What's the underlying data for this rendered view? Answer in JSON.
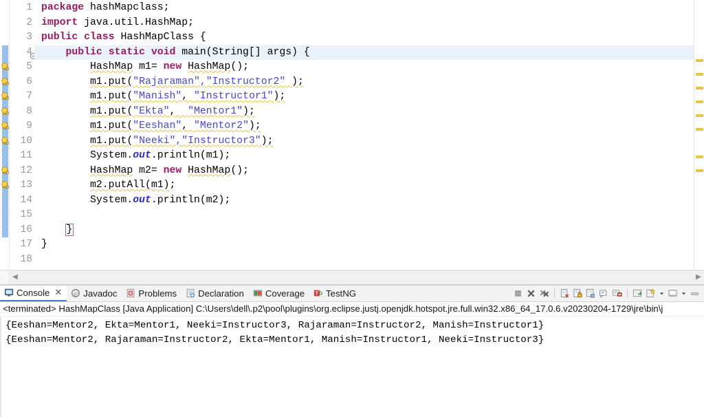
{
  "editor": {
    "name": "java-code-editor",
    "total_lines": 18,
    "highlighted_line": 4,
    "lines": [
      {
        "n": 1,
        "warn": false,
        "changed": false,
        "fold": false,
        "tokens": [
          {
            "t": "package",
            "c": "kw"
          },
          {
            "t": " hashMapclass;",
            "c": "plain"
          }
        ]
      },
      {
        "n": 2,
        "warn": false,
        "changed": false,
        "fold": false,
        "tokens": [
          {
            "t": "import",
            "c": "kw"
          },
          {
            "t": " java.util.HashMap;",
            "c": "plain"
          }
        ]
      },
      {
        "n": 3,
        "warn": false,
        "changed": false,
        "fold": false,
        "tokens": [
          {
            "t": "public class",
            "c": "kw"
          },
          {
            "t": " HashMapClass {",
            "c": "plain"
          }
        ]
      },
      {
        "n": 4,
        "warn": false,
        "changed": true,
        "fold": true,
        "tokens": [
          {
            "t": "    ",
            "c": "plain"
          },
          {
            "t": "public static void",
            "c": "kw"
          },
          {
            "t": " main(String[] args) {",
            "c": "plain"
          }
        ]
      },
      {
        "n": 5,
        "warn": true,
        "changed": true,
        "fold": false,
        "tokens": [
          {
            "t": "        ",
            "c": "plain"
          },
          {
            "t": "HashMap",
            "c": "sq"
          },
          {
            "t": " m1= ",
            "c": "plain"
          },
          {
            "t": "new",
            "c": "kw"
          },
          {
            "t": " ",
            "c": "plain"
          },
          {
            "t": "HashMap",
            "c": "sq"
          },
          {
            "t": "();",
            "c": "plain"
          }
        ]
      },
      {
        "n": 6,
        "warn": true,
        "changed": true,
        "fold": false,
        "tokens": [
          {
            "t": "        ",
            "c": "plain"
          },
          {
            "t": "m1.put(",
            "c": "sq"
          },
          {
            "t": "\"Rajaraman\",\"Instructor2\"",
            "c": "str sq"
          },
          {
            "t": " );",
            "c": "sq"
          }
        ]
      },
      {
        "n": 7,
        "warn": true,
        "changed": true,
        "fold": false,
        "tokens": [
          {
            "t": "        ",
            "c": "plain"
          },
          {
            "t": "m1.put(",
            "c": "sq"
          },
          {
            "t": "\"Manish\"",
            "c": "str sq"
          },
          {
            "t": ", ",
            "c": "sq"
          },
          {
            "t": "\"Instructor1\"",
            "c": "str sq"
          },
          {
            "t": ");",
            "c": "sq"
          }
        ]
      },
      {
        "n": 8,
        "warn": true,
        "changed": true,
        "fold": false,
        "tokens": [
          {
            "t": "        ",
            "c": "plain"
          },
          {
            "t": "m1.put(",
            "c": "sq"
          },
          {
            "t": "\"Ekta\"",
            "c": "str sq"
          },
          {
            "t": ",  ",
            "c": "sq"
          },
          {
            "t": "\"Mentor1\"",
            "c": "str sq"
          },
          {
            "t": ");",
            "c": "sq"
          }
        ]
      },
      {
        "n": 9,
        "warn": true,
        "changed": true,
        "fold": false,
        "tokens": [
          {
            "t": "        ",
            "c": "plain"
          },
          {
            "t": "m1.put(",
            "c": "sq"
          },
          {
            "t": "\"Eeshan\"",
            "c": "str sq"
          },
          {
            "t": ", ",
            "c": "sq"
          },
          {
            "t": "\"Mentor2\"",
            "c": "str sq"
          },
          {
            "t": ");",
            "c": "sq"
          }
        ]
      },
      {
        "n": 10,
        "warn": true,
        "changed": true,
        "fold": false,
        "tokens": [
          {
            "t": "        ",
            "c": "plain"
          },
          {
            "t": "m1.put(",
            "c": "sq"
          },
          {
            "t": "\"Neeki\",\"Instructor3\"",
            "c": "str sq"
          },
          {
            "t": ");",
            "c": "sq"
          }
        ]
      },
      {
        "n": 11,
        "warn": false,
        "changed": true,
        "fold": false,
        "tokens": [
          {
            "t": "        System.",
            "c": "plain"
          },
          {
            "t": "out",
            "c": "fld"
          },
          {
            "t": ".println(m1);",
            "c": "plain"
          }
        ]
      },
      {
        "n": 12,
        "warn": true,
        "changed": true,
        "fold": false,
        "tokens": [
          {
            "t": "        ",
            "c": "plain"
          },
          {
            "t": "HashMap",
            "c": "sq"
          },
          {
            "t": " m2= ",
            "c": "plain"
          },
          {
            "t": "new",
            "c": "kw"
          },
          {
            "t": " ",
            "c": "plain"
          },
          {
            "t": "HashMap",
            "c": "sq"
          },
          {
            "t": "();",
            "c": "plain"
          }
        ]
      },
      {
        "n": 13,
        "warn": true,
        "changed": true,
        "fold": false,
        "tokens": [
          {
            "t": "        ",
            "c": "plain"
          },
          {
            "t": "m2.putAll(m1)",
            "c": "sq"
          },
          {
            "t": ";",
            "c": "plain"
          }
        ]
      },
      {
        "n": 14,
        "warn": false,
        "changed": true,
        "fold": false,
        "tokens": [
          {
            "t": "        System.",
            "c": "plain"
          },
          {
            "t": "out",
            "c": "fld"
          },
          {
            "t": ".println(m2);",
            "c": "plain"
          }
        ]
      },
      {
        "n": 15,
        "warn": false,
        "changed": true,
        "fold": false,
        "tokens": [
          {
            "t": "",
            "c": "plain"
          }
        ]
      },
      {
        "n": 16,
        "warn": false,
        "changed": true,
        "fold": false,
        "tokens": [
          {
            "t": "    ",
            "c": "plain"
          },
          {
            "t": "}",
            "c": "brkt"
          }
        ]
      },
      {
        "n": 17,
        "warn": false,
        "changed": false,
        "fold": false,
        "tokens": [
          {
            "t": "}",
            "c": "plain"
          }
        ]
      },
      {
        "n": 18,
        "warn": false,
        "changed": false,
        "fold": false,
        "tokens": [
          {
            "t": "",
            "c": "plain"
          }
        ]
      }
    ],
    "scrollbar": {
      "left_arrow": "◀",
      "right_arrow": "▶"
    }
  },
  "console": {
    "tabs": [
      {
        "label": "Console",
        "icon": "console-icon",
        "active": true,
        "closable": true,
        "close_glyph": "✕"
      },
      {
        "label": "Javadoc",
        "icon": "javadoc-icon",
        "active": false,
        "closable": false
      },
      {
        "label": "Problems",
        "icon": "problems-icon",
        "active": false,
        "closable": false
      },
      {
        "label": "Declaration",
        "icon": "declaration-icon",
        "active": false,
        "closable": false
      },
      {
        "label": "Coverage",
        "icon": "coverage-icon",
        "active": false,
        "closable": false
      },
      {
        "label": "TestNG",
        "icon": "testng-icon",
        "active": false,
        "closable": false
      }
    ],
    "toolbar_icons": [
      "terminate-icon",
      "remove-launch-icon",
      "remove-all-terminated-icon",
      "separator",
      "clear-console-icon",
      "scroll-lock-icon",
      "show-console-when-output-icon",
      "pin-console-icon",
      "display-selected-console-icon",
      "separator",
      "open-console-icon",
      "new-console-view-icon",
      "open-console-dropdown-caret",
      "view-menu-icon",
      "view-menu-caret",
      "minimize-icon"
    ],
    "terminated_line": "<terminated> HashMapClass [Java Application] C:\\Users\\dell\\.p2\\pool\\plugins\\org.eclipse.justj.openjdk.hotspot.jre.full.win32.x86_64_17.0.6.v20230204-1729\\jre\\bin\\j",
    "output_lines": [
      "{Eeshan=Mentor2, Ekta=Mentor1, Neeki=Instructor3, Rajaraman=Instructor2, Manish=Instructor1}",
      "{Eeshan=Mentor2, Rajaraman=Instructor2, Ekta=Mentor1, Manish=Instructor1, Neeki=Instructor3}"
    ]
  },
  "colors": {
    "keyword": "#9b1b62",
    "string": "#4646d2",
    "field": "#2a2ad0",
    "warning_squiggle": "#e8c547",
    "changed_bar": "#7aaee8",
    "line_highlight": "#eaf2fb",
    "tab_active_underline": "#3a7fd5",
    "bracket_box": "#b05ea8"
  }
}
